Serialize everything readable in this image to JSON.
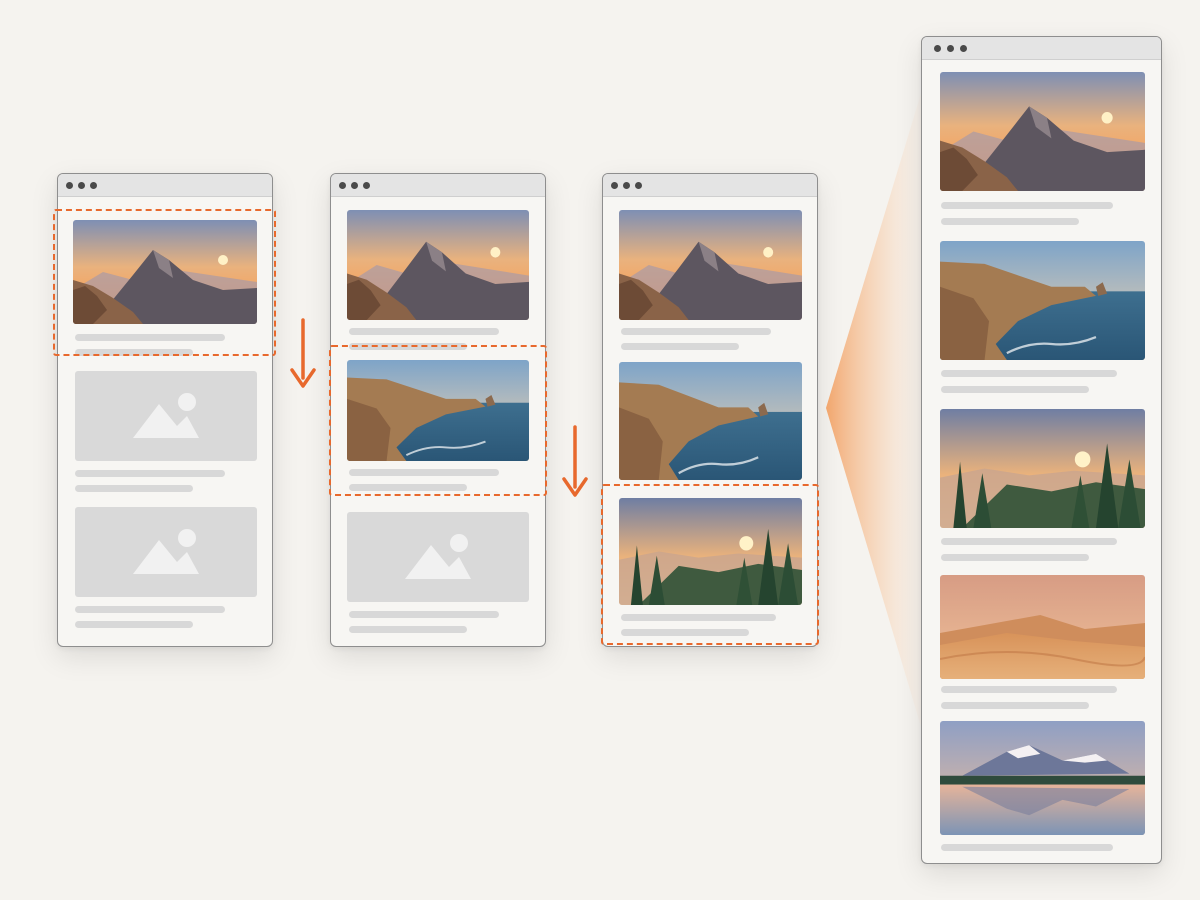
{
  "diagram": {
    "type": "lazy-loading-scroll-sequence",
    "accent_color": "#e8692d",
    "frame_color": "#8e8e8e",
    "placeholder_color": "#d9d9d9",
    "icons": [
      "window-dots-icon",
      "image-placeholder-icon",
      "down-arrow-icon"
    ]
  },
  "stages": [
    {
      "loaded": [
        "mountain"
      ],
      "placeholders": 2,
      "highlight": "mountain"
    },
    {
      "loaded": [
        "mountain",
        "coast"
      ],
      "placeholders": 1,
      "highlight": "coast"
    },
    {
      "loaded": [
        "mountain",
        "coast",
        "forest"
      ],
      "placeholders": 0,
      "highlight": "forest"
    }
  ],
  "full_page": {
    "loaded": [
      "mountain",
      "coast",
      "forest",
      "desert",
      "lake"
    ]
  }
}
